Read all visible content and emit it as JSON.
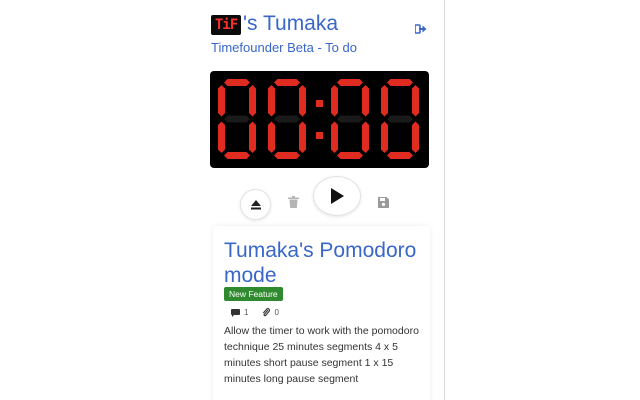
{
  "header": {
    "logo_text": "TiF",
    "title": "'s Tumaka",
    "subtitle": "Timefounder Beta - To do"
  },
  "timer": {
    "display": "00:00",
    "digit_color": "#e02b20",
    "background": "#000000"
  },
  "controls": {
    "icons": [
      "eject-icon",
      "trash-icon",
      "play-icon",
      "save-icon"
    ]
  },
  "card": {
    "title": "Tumaka's Pomodoro mode",
    "badge": "New Feature",
    "badge_color": "#2f8a2f",
    "comments_count": "1",
    "attachments_count": "0",
    "description": "Allow the timer to work with the pomodoro technique 25 minutes segments 4 x 5 minutes short pause segment 1 x 15 minutes long pause segment"
  },
  "colors": {
    "accent": "#3867c8"
  }
}
